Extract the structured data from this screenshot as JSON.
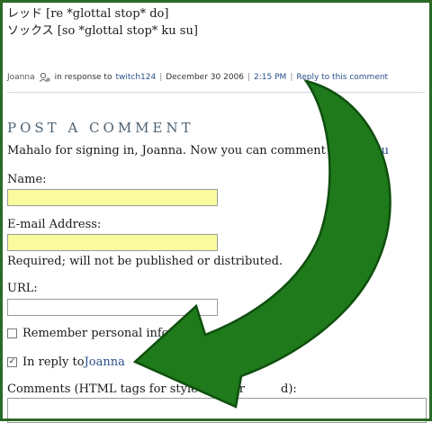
{
  "comment": {
    "line1": "レッド [re *glottal stop* do]",
    "line2": "ソックス [so *glottal stop* ku su]",
    "meta": {
      "author": "Joanna",
      "in_response_prefix": "in response to",
      "in_response_user": "twitch124",
      "date": "December 30 2006",
      "time": "2:15 PM",
      "reply_link": "Reply to this comment",
      "sep": "|"
    }
  },
  "form": {
    "title": "POST A COMMENT",
    "signed_in_text": "Mahalo for signing in, Joanna. Now you can comment or ",
    "sign_out_link": "sign ou",
    "name_label": "Name:",
    "name_value": "",
    "email_label": "E-mail Address:",
    "email_value": "",
    "email_note": "Required; will not be published or distributed.",
    "url_label": "URL:",
    "url_value": "",
    "remember_label": "Remember personal info?",
    "remember_checked": false,
    "in_reply_prefix": "In reply to ",
    "in_reply_user": "Joanna",
    "in_reply_checked": true,
    "comments_label_start": "Comments (HTML tags for style are per",
    "comments_label_end": "d):"
  },
  "colors": {
    "frame": "#2c6a27",
    "arrow_fill": "#1e7a1b",
    "link": "#2b4f8a",
    "field_fill": "#fafa9e",
    "title": "#4d6273"
  }
}
